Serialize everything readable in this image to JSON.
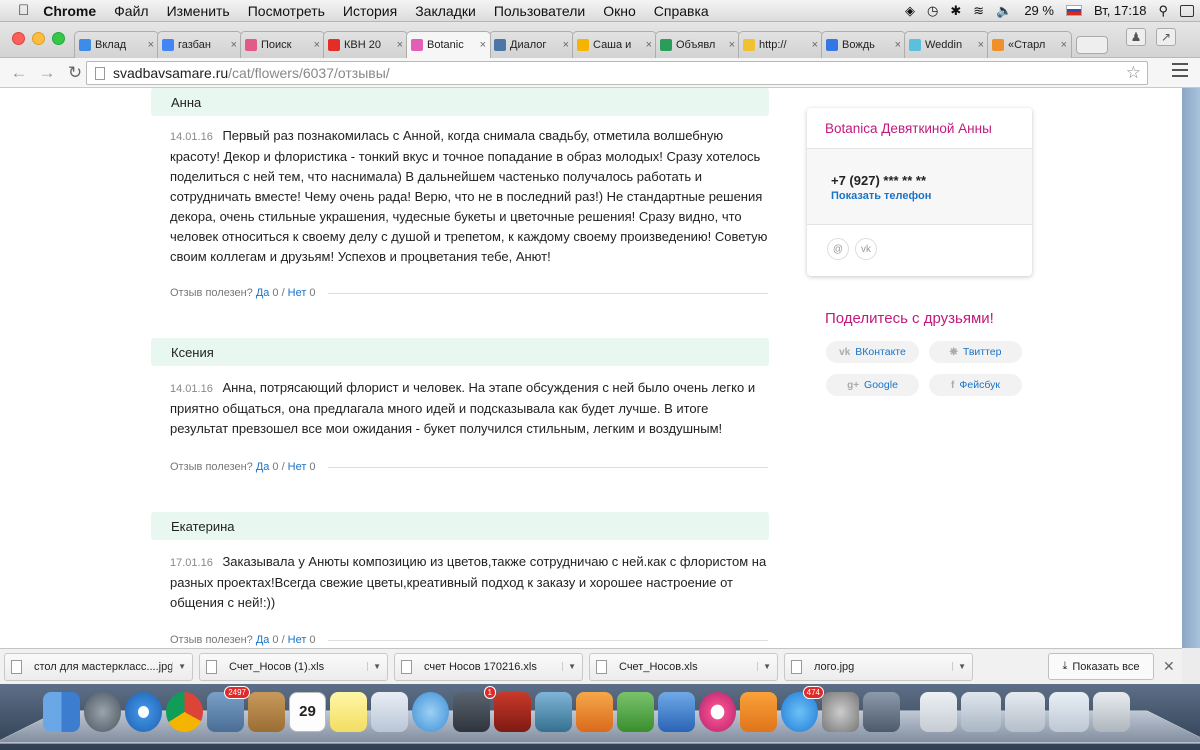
{
  "menubar": {
    "apple": "",
    "items": [
      "Chrome",
      "Файл",
      "Изменить",
      "Посмотреть",
      "История",
      "Закладки",
      "Пользователи",
      "Окно",
      "Справка"
    ],
    "battery": "29 %",
    "clock": "Вт, 17:18"
  },
  "tabs": [
    {
      "title": "Вклад",
      "color": "#3f8ce8"
    },
    {
      "title": "газбан",
      "color": "#4285f4"
    },
    {
      "title": "Поиск",
      "color": "#e05a8a"
    },
    {
      "title": "КВН 20",
      "color": "#e52d27"
    },
    {
      "title": "Botanic",
      "color": "#e25fb3",
      "active": true
    },
    {
      "title": "Диалог",
      "color": "#4a76a8"
    },
    {
      "title": "Саша и",
      "color": "#f4b400"
    },
    {
      "title": "Объявл",
      "color": "#2a9d5b"
    },
    {
      "title": "http://",
      "color": "#f0c230"
    },
    {
      "title": "Вождь",
      "color": "#3578e5"
    },
    {
      "title": "Weddin",
      "color": "#5bc0de"
    },
    {
      "title": "«Старл",
      "color": "#f0902a"
    }
  ],
  "address": {
    "host": "svadbavsamare.ru",
    "path": "/cat/flowers/6037/отзывы/"
  },
  "reviews": [
    {
      "author": "Анна",
      "date": "14.01.16",
      "text": "Первый раз познакомилась с Анной, когда снимала свадьбу, отметила волшебную красоту! Декор и флористика - тонкий вкус и точное попадание в образ молодых! Сразу хотелось поделиться с ней тем, что наснимала) В дальнейшем частенько получалось работать и сотрудничать вместе! Чему очень рада! Верю, что не в последний раз!) Не стандартные решения декора, очень стильные украшения, чудесные букеты и цветочные решения! Сразу видно, что человек относиться к своему делу с душой и трепетом, к каждому своему произведению! Советую своим коллегам и друзьям! Успехов и процветания тебе, Анют!",
      "useful_label": "Отзыв полезен?",
      "yes_label": "Да",
      "yes_count": "0",
      "sep": "/",
      "no_label": "Нет",
      "no_count": "0"
    },
    {
      "author": "Ксения",
      "date": "14.01.16",
      "text": "Анна, потрясающий флорист и человек. На этапе обсуждения с ней было очень легко и приятно общаться, она предлагала много идей и подсказывала как будет лучше. В итоге результат превзошел все мои ожидания - букет получился стильным, легким и воздушным!",
      "useful_label": "Отзыв полезен?",
      "yes_label": "Да",
      "yes_count": "0",
      "sep": "/",
      "no_label": "Нет",
      "no_count": "0"
    },
    {
      "author": "Екатерина",
      "date": "17.01.16",
      "text": "Заказывала у Анюты композицию из цветов,также сотрудничаю с ней.как с флористом на разных проектах!Всегда свежие цветы,креативный подход к заказу и хорошее настроение от общения с ней!:))",
      "useful_label": "Отзыв полезен?",
      "yes_label": "Да",
      "yes_count": "0",
      "sep": "/",
      "no_label": "Нет",
      "no_count": "0"
    }
  ],
  "vendor": {
    "name": "Botanica Девяткиной Анны",
    "phone": "+7 (927) *** ** **",
    "show_phone": "Показать телефон",
    "social": [
      "@",
      "vk"
    ]
  },
  "share": {
    "title": "Поделитесь с друзьями!",
    "buttons": [
      {
        "icon": "vk",
        "label": "ВКонтакте"
      },
      {
        "icon": "twitter",
        "label": "Твиттер"
      },
      {
        "icon": "g+",
        "label": "Google"
      },
      {
        "icon": "f",
        "label": "Фейсбук"
      }
    ]
  },
  "downloads": {
    "items": [
      "стол для мастеркласс....jpg",
      "Счет_Носов (1).xls",
      "счет Носов 170216.xls",
      "Счет_Носов.xls",
      "лого.jpg"
    ],
    "show_all": "Показать все"
  },
  "dock": {
    "badges": {
      "mail": "2497",
      "facetime": "1",
      "appstore": "474"
    },
    "calendar_day": "29"
  },
  "colors": {
    "accent_pink": "#c2197d",
    "link_blue": "#1a73c7",
    "review_header_bg": "#e8f8f1"
  }
}
